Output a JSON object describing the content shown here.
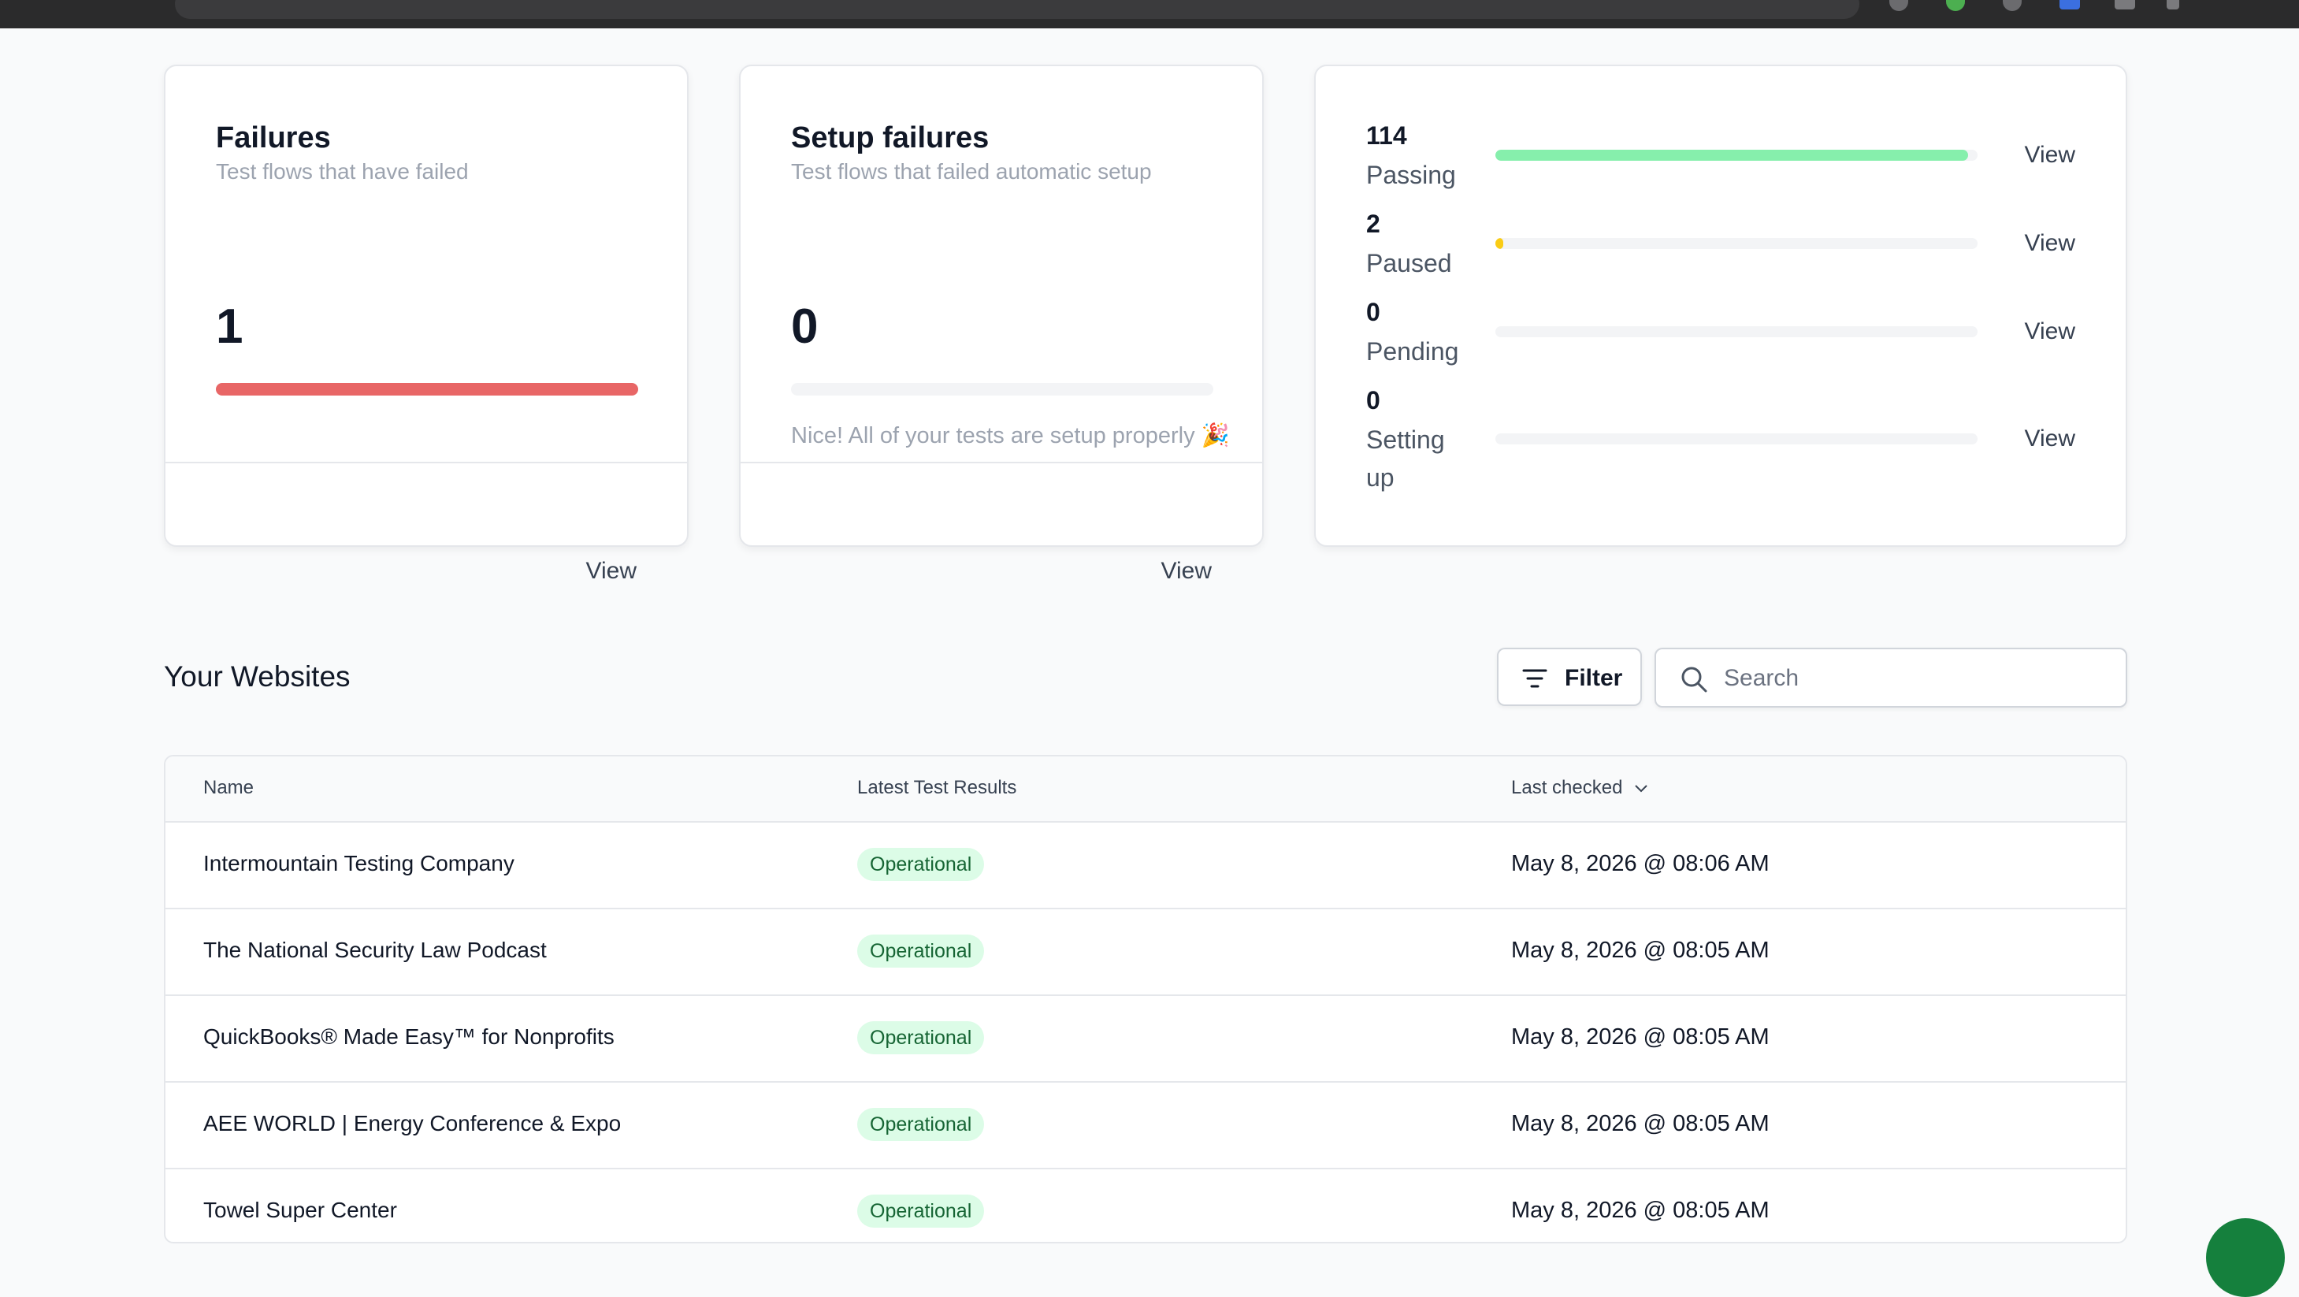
{
  "cards": {
    "failures": {
      "title": "Failures",
      "subtitle": "Test flows that have failed",
      "count": "1",
      "bar_fraction": 1.0,
      "bar_color": "#e86666",
      "view_label": "View"
    },
    "setup_failures": {
      "title": "Setup failures",
      "subtitle": "Test flows that failed automatic setup",
      "count": "0",
      "bar_fraction": 0,
      "message": "Nice! All of your tests are setup properly 🎉",
      "view_label": "View"
    },
    "status": {
      "items": [
        {
          "count": "114",
          "label": "Passing",
          "fraction": 0.98,
          "color": "#86efac",
          "view_label": "View"
        },
        {
          "count": "2",
          "label": "Paused",
          "fraction": 0.017,
          "color": "#facc15",
          "view_label": "View"
        },
        {
          "count": "0",
          "label": "Pending",
          "fraction": 0,
          "color": "#d1d5db",
          "view_label": "View"
        },
        {
          "count": "0",
          "label": "Setting up",
          "fraction": 0,
          "color": "#d1d5db",
          "view_label": "View"
        }
      ]
    }
  },
  "websites": {
    "title": "Your Websites",
    "filter_label": "Filter",
    "search_placeholder": "Search",
    "columns": [
      "Name",
      "Latest Test Results",
      "Last checked"
    ],
    "rows": [
      {
        "name": "Intermountain Testing Company",
        "status": "Operational",
        "last_checked": "May 8, 2026 @ 08:06 AM"
      },
      {
        "name": "The National Security Law Podcast",
        "status": "Operational",
        "last_checked": "May 8, 2026 @ 08:05 AM"
      },
      {
        "name": "QuickBooks® Made Easy™ for Nonprofits",
        "status": "Operational",
        "last_checked": "May 8, 2026 @ 08:05 AM"
      },
      {
        "name": "AEE WORLD | Energy Conference & Expo",
        "status": "Operational",
        "last_checked": "May 8, 2026 @ 08:05 AM"
      },
      {
        "name": "Towel Super Center",
        "status": "Operational",
        "last_checked": "May 8, 2026 @ 08:05 AM"
      }
    ]
  }
}
